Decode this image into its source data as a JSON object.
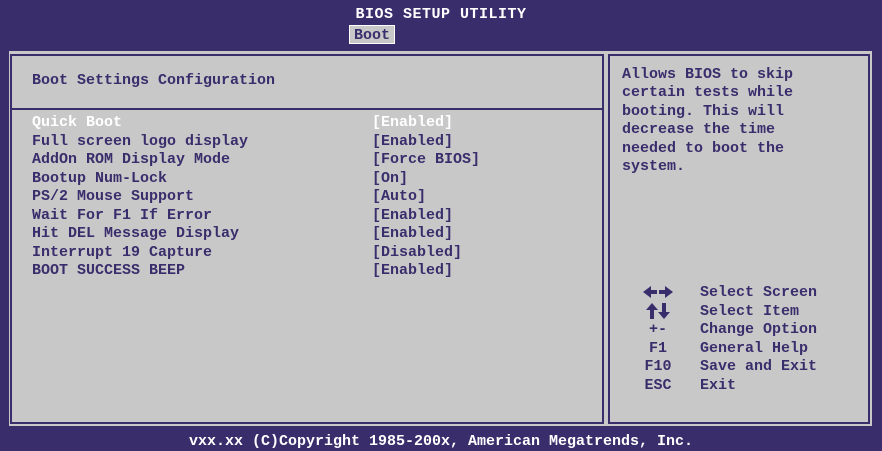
{
  "header": {
    "title": "BIOS SETUP UTILITY",
    "active_tab": "Boot"
  },
  "main": {
    "heading": "Boot Settings Configuration",
    "settings": [
      {
        "label": "Quick Boot",
        "value": "[Enabled]",
        "selected": true
      },
      {
        "label": "Full screen logo display",
        "value": "[Enabled]"
      },
      {
        "label": "AddOn ROM Display Mode",
        "value": "[Force BIOS]"
      },
      {
        "label": "Bootup Num-Lock",
        "value": "[On]"
      },
      {
        "label": "PS/2 Mouse Support",
        "value": "[Auto]"
      },
      {
        "label": "Wait For F1 If Error",
        "value": "[Enabled]"
      },
      {
        "label": "Hit DEL Message Display",
        "value": "[Enabled]"
      },
      {
        "label": "Interrupt 19 Capture",
        "value": "[Disabled]"
      },
      {
        "label": "BOOT SUCCESS BEEP",
        "value": "[Enabled]"
      }
    ]
  },
  "help_text": "Allows BIOS to skip\ncertain tests while\nbooting. This will\ndecrease the time\nneeded to boot the\nsystem.",
  "keys": [
    {
      "key": "left-right-arrows-icon",
      "desc": "Select Screen"
    },
    {
      "key": "up-down-arrows-icon",
      "desc": "Select Item"
    },
    {
      "key": "+-",
      "desc": "Change Option"
    },
    {
      "key": "F1",
      "desc": "General Help"
    },
    {
      "key": "F10",
      "desc": "Save and Exit"
    },
    {
      "key": "ESC",
      "desc": "Exit"
    }
  ],
  "footer": "vxx.xx (C)Copyright 1985-200x, American Megatrends, Inc.",
  "colors": {
    "background": "#3a2d6c",
    "panel": "#c8c8c8",
    "text": "#3a2d6c",
    "highlight": "#ffffff"
  }
}
